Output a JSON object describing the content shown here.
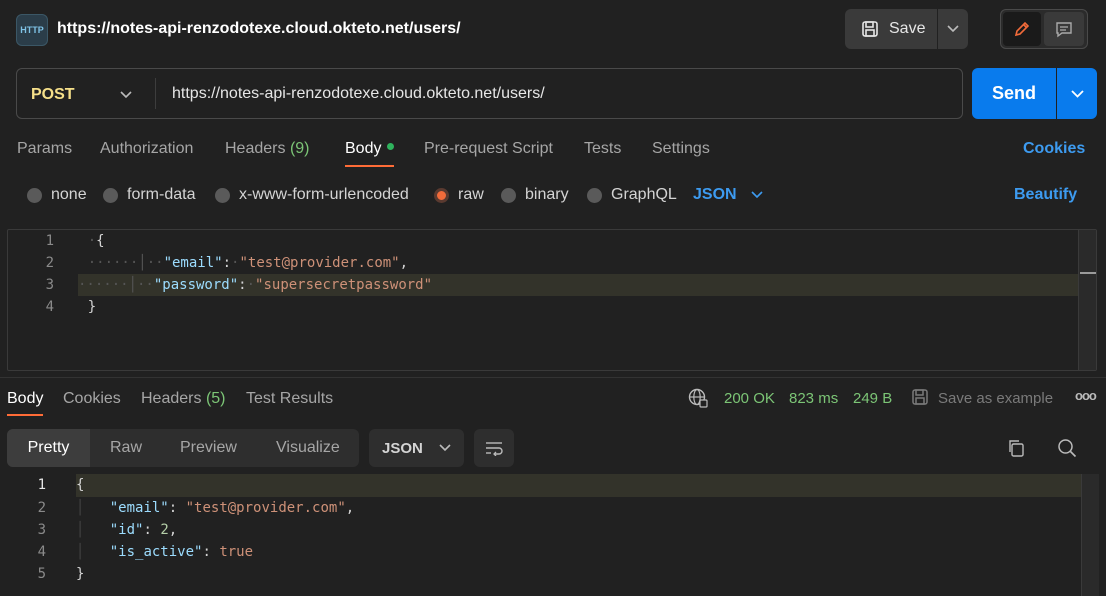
{
  "request": {
    "title": "https://notes-api-renzodotexe.cloud.okteto.net/users/",
    "icon_label": "HTTP",
    "method": "POST",
    "url": "https://notes-api-renzodotexe.cloud.okteto.net/users/",
    "save_label": "Save",
    "send_label": "Send"
  },
  "request_tabs": {
    "params": "Params",
    "authorization": "Authorization",
    "headers": "Headers",
    "headers_count": "(9)",
    "body": "Body",
    "prerequest": "Pre-request Script",
    "tests": "Tests",
    "settings": "Settings",
    "cookies": "Cookies"
  },
  "body_types": {
    "none": "none",
    "form_data": "form-data",
    "urlencoded": "x-www-form-urlencoded",
    "raw": "raw",
    "binary": "binary",
    "graphql": "GraphQL",
    "format": "JSON",
    "beautify": "Beautify"
  },
  "request_body": {
    "line_numbers": [
      "1",
      "2",
      "3",
      "4"
    ],
    "open": "{",
    "close": "}",
    "k1": "\"email\"",
    "v1": "\"test@provider.com\"",
    "k2": "\"password\"",
    "v2": "\"supersecretpassword\""
  },
  "response_tabs": {
    "body": "Body",
    "cookies": "Cookies",
    "headers": "Headers",
    "headers_count": "(5)",
    "test_results": "Test Results"
  },
  "response_status": {
    "status": "200 OK",
    "time": "823 ms",
    "size": "249 B",
    "save_example": "Save as example",
    "more": "ooo"
  },
  "response_views": {
    "pretty": "Pretty",
    "raw": "Raw",
    "preview": "Preview",
    "visualize": "Visualize",
    "format": "JSON"
  },
  "response_body": {
    "line_numbers": [
      "1",
      "2",
      "3",
      "4",
      "5"
    ],
    "open": "{",
    "close": "}",
    "k1": "\"email\"",
    "v1": "\"test@provider.com\"",
    "k2": "\"id\"",
    "v2": "2",
    "k3": "\"is_active\"",
    "v3": "true"
  },
  "colors": {
    "accent_orange": "#ff6c37",
    "send_blue": "#097bed",
    "link_blue": "#3d9bf0",
    "method_yellow": "#f6e08a",
    "status_green": "#7cc576"
  }
}
